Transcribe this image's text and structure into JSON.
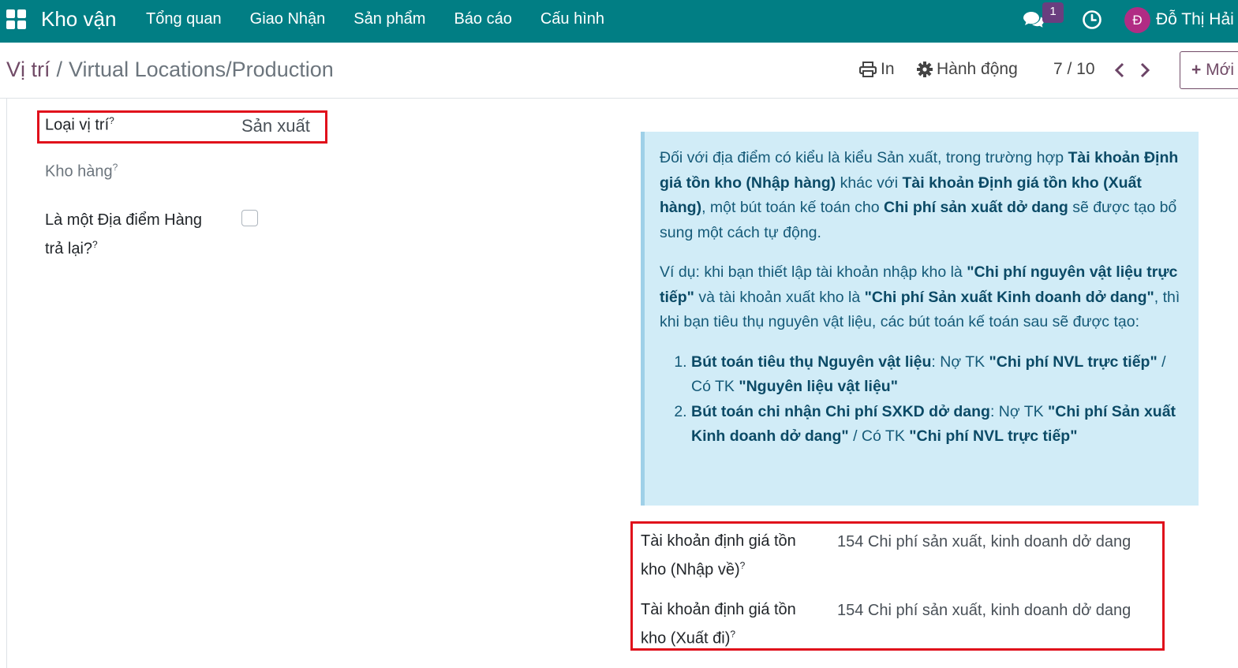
{
  "navbar": {
    "brand": "Kho vận",
    "menu": [
      "Tổng quan",
      "Giao Nhận",
      "Sản phẩm",
      "Báo cáo",
      "Cấu hình"
    ],
    "chat_badge": "1",
    "avatar_letter": "Đ",
    "username": "Đỗ Thị Hải",
    "bg_color": "#017e84"
  },
  "control": {
    "breadcrumb_parent": "Vị trí",
    "breadcrumb_sep": "/",
    "breadcrumb_current": "Virtual Locations/Production",
    "print_label": "In",
    "action_label": "Hành động",
    "pager": "7 / 10",
    "new_label": "Mới"
  },
  "form": {
    "location_type_label": "Loại vị trí",
    "location_type_value": "Sản xuất",
    "warehouse_label": "Kho hàng",
    "return_location_label_1": "Là một Địa điểm Hàng",
    "return_location_label_2": "trả lại?",
    "return_location_checked": false,
    "help_mark": "?"
  },
  "alert": {
    "p1": [
      "Đối với địa điểm có kiểu là kiểu Sản xuất, trong trường hợp ",
      "Tài khoản Định giá tồn kho (Nhập hàng)",
      " khác với ",
      "Tài khoản Định giá tồn kho (Xuất hàng)",
      ", một bút toán kế toán cho ",
      "Chi phí sản xuất dở dang",
      " sẽ được tạo bổ sung một cách tự động."
    ],
    "p2": [
      "Ví dụ: khi bạn thiết lập tài khoản nhập kho là ",
      "\"Chi phí nguyên vật liệu trực tiếp\"",
      " và tài khoản xuất kho là ",
      "\"Chi phí Sản xuất Kinh doanh dở dang\"",
      ", thì khi bạn tiêu thụ nguyên vật liệu, các bút toán kế toán sau sẽ được tạo:"
    ],
    "li1": [
      "Bút toán tiêu thụ Nguyên vật liệu",
      ": Nợ TK ",
      "\"Chi phí NVL trực tiếp\"",
      " / Có TK ",
      "\"Nguyên liệu vật liệu\""
    ],
    "li2": [
      "Bút toán chi nhận Chi phí SXKD dở dang",
      ": Nợ TK ",
      "\"Chi phí Sản xuất Kinh doanh dở dang\"",
      " / Có TK ",
      "\"Chi phí NVL trực tiếp\""
    ]
  },
  "accounts": {
    "in_label_1": "Tài khoản định giá tồn",
    "in_label_2": "kho (Nhập về)",
    "in_value": "154 Chi phí sản xuất, kinh doanh dở dang",
    "out_label_1": "Tài khoản định giá tồn",
    "out_label_2": "kho (Xuất đi)",
    "out_value": "154 Chi phí sản xuất, kinh doanh dở dang"
  }
}
